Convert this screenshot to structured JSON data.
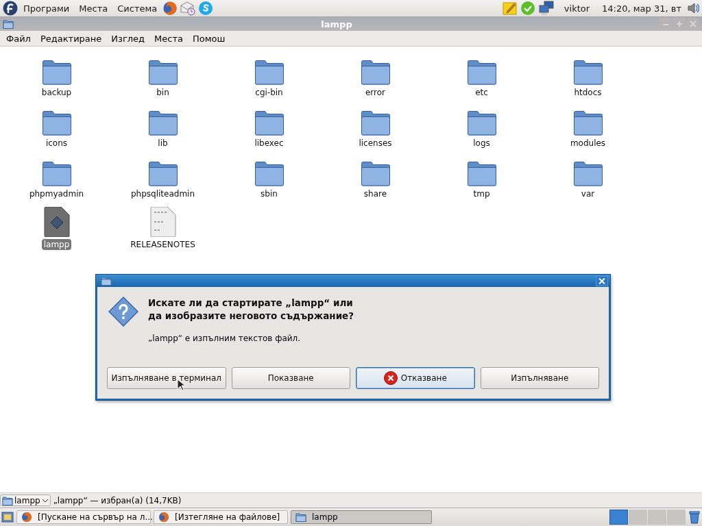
{
  "top_panel": {
    "menus": [
      "Програми",
      "Места",
      "Система"
    ],
    "launchers": [
      {
        "kind": "browser"
      },
      {
        "kind": "mail"
      },
      {
        "kind": "chat"
      }
    ],
    "tray": [
      {
        "kind": "notes"
      },
      {
        "kind": "chat-status"
      },
      {
        "kind": "network"
      }
    ],
    "user": "viktor",
    "clock": "14:20, мар 31, вт"
  },
  "window": {
    "title": "lampp",
    "menu": [
      "Файл",
      "Редактиране",
      "Изглед",
      "Места",
      "Помош"
    ],
    "files": [
      {
        "name": "backup",
        "kind": "folder",
        "selected": false
      },
      {
        "name": "bin",
        "kind": "folder",
        "selected": false
      },
      {
        "name": "cgi-bin",
        "kind": "folder",
        "selected": false
      },
      {
        "name": "error",
        "kind": "folder",
        "selected": false
      },
      {
        "name": "etc",
        "kind": "folder",
        "selected": false
      },
      {
        "name": "htdocs",
        "kind": "folder",
        "selected": false
      },
      {
        "name": "icons",
        "kind": "folder",
        "selected": false
      },
      {
        "name": "lib",
        "kind": "folder",
        "selected": false
      },
      {
        "name": "libexec",
        "kind": "folder",
        "selected": false
      },
      {
        "name": "licenses",
        "kind": "folder",
        "selected": false
      },
      {
        "name": "logs",
        "kind": "folder",
        "selected": false
      },
      {
        "name": "modules",
        "kind": "folder",
        "selected": false
      },
      {
        "name": "phpmyadmin",
        "kind": "folder",
        "selected": false
      },
      {
        "name": "phpsqliteadmin",
        "kind": "folder",
        "selected": false
      },
      {
        "name": "sbin",
        "kind": "folder",
        "selected": false
      },
      {
        "name": "share",
        "kind": "folder",
        "selected": false
      },
      {
        "name": "tmp",
        "kind": "folder",
        "selected": false
      },
      {
        "name": "var",
        "kind": "folder",
        "selected": false
      },
      {
        "name": "lampp",
        "kind": "script",
        "selected": true
      },
      {
        "name": "RELEASENOTES",
        "kind": "text",
        "selected": false
      }
    ],
    "status_bar": {
      "location": "lampp",
      "message": "„lampp“ — избран(а) (14,7KB)"
    }
  },
  "dialog": {
    "question": "Искате ли да стартирате „lampp“ или да изобразите неговото съдържание?",
    "message": "„lampp“ е изпълним текстов файл.",
    "buttons": [
      {
        "label": "Изпълняване в терминал",
        "default": false
      },
      {
        "label": "Показване",
        "default": false
      },
      {
        "label": "Отказване",
        "default": true
      },
      {
        "label": "Изпълняване",
        "default": false
      }
    ]
  },
  "taskbar": {
    "items": [
      {
        "label": "[Пускане на сървър на л...",
        "kind": "browser",
        "selected": false
      },
      {
        "label": "[Изтегляне на файлове]",
        "kind": "browser",
        "selected": false
      },
      {
        "label": "lampp",
        "kind": "folder",
        "selected": true
      }
    ],
    "workspaces": [
      {
        "selected": true
      },
      {
        "selected": false
      },
      {
        "selected": false
      },
      {
        "selected": false
      }
    ]
  }
}
